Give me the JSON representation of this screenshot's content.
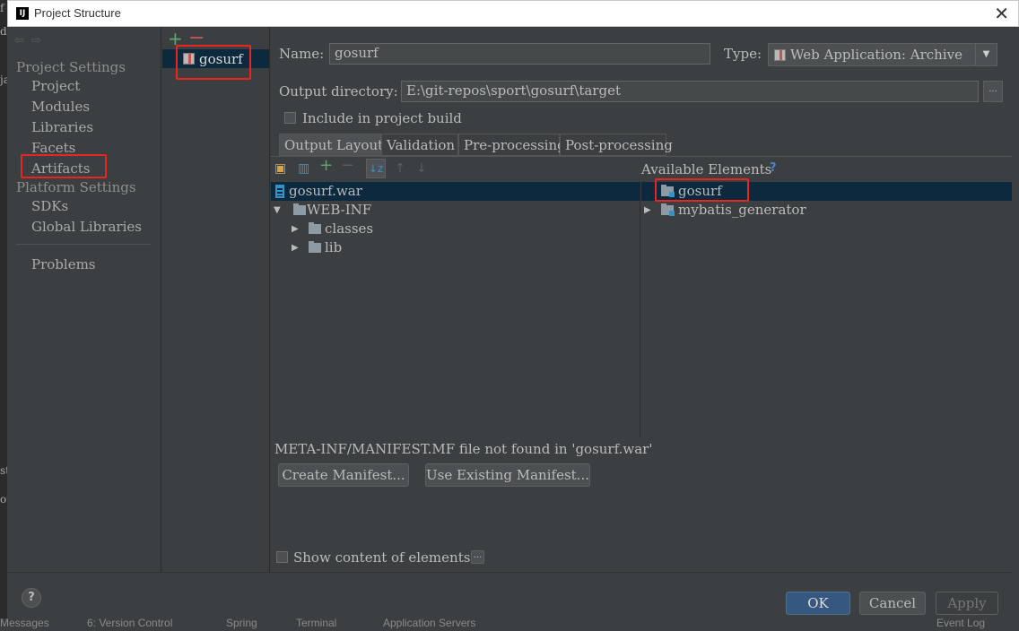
{
  "window": {
    "title": "Project Structure",
    "app_icon": "IJ"
  },
  "nav": {
    "sections": [
      {
        "label": "Project Settings",
        "items": [
          "Project",
          "Modules",
          "Libraries",
          "Facets",
          "Artifacts"
        ]
      },
      {
        "label": "Platform Settings",
        "items": [
          "SDKs",
          "Global Libraries"
        ]
      }
    ],
    "problems": "Problems",
    "selected": "Artifacts"
  },
  "artifact_list": {
    "items": [
      "gosurf"
    ],
    "selected": "gosurf"
  },
  "form": {
    "name_label": "Name:",
    "name_value": "gosurf",
    "type_label": "Type:",
    "type_value": "Web Application: Archive",
    "output_label": "Output directory:",
    "output_value": "E:\\git-repos\\sport\\gosurf\\target",
    "browse_label": "...",
    "include_build_label": "Include in project build",
    "include_build_checked": false
  },
  "tabs": [
    "Output Layout",
    "Validation",
    "Pre-processing",
    "Post-processing"
  ],
  "active_tab": "Output Layout",
  "output_tree": [
    {
      "label": "gosurf.war",
      "kind": "war",
      "level": 0,
      "expanded": null,
      "selected": true
    },
    {
      "label": "WEB-INF",
      "kind": "folder",
      "level": 0,
      "expanded": true
    },
    {
      "label": "classes",
      "kind": "folder",
      "level": 1,
      "expanded": false
    },
    {
      "label": "lib",
      "kind": "folder",
      "level": 1,
      "expanded": false
    }
  ],
  "available": {
    "title": "Available Elements",
    "help": "?",
    "items": [
      {
        "label": "gosurf",
        "selected": true
      },
      {
        "label": "mybatis_generator",
        "selected": false
      }
    ]
  },
  "manifest": {
    "message": "META-INF/MANIFEST.MF file not found in 'gosurf.war'",
    "create_label": "Create Manifest...",
    "use_existing_label": "Use Existing Manifest..."
  },
  "show_content": {
    "label": "Show content of elements",
    "checked": false,
    "more": "..."
  },
  "footer": {
    "help": "?",
    "ok": "OK",
    "cancel": "Cancel",
    "apply": "Apply"
  },
  "background_tool_windows": [
    "Messages",
    "6: Version Control",
    "Spring",
    "Terminal",
    "Application Servers",
    "Event Log"
  ],
  "colors": {
    "highlight_box": "#e8261f",
    "selection": "#0d293e",
    "background": "#3c3f41",
    "ok_button": "#365880"
  }
}
